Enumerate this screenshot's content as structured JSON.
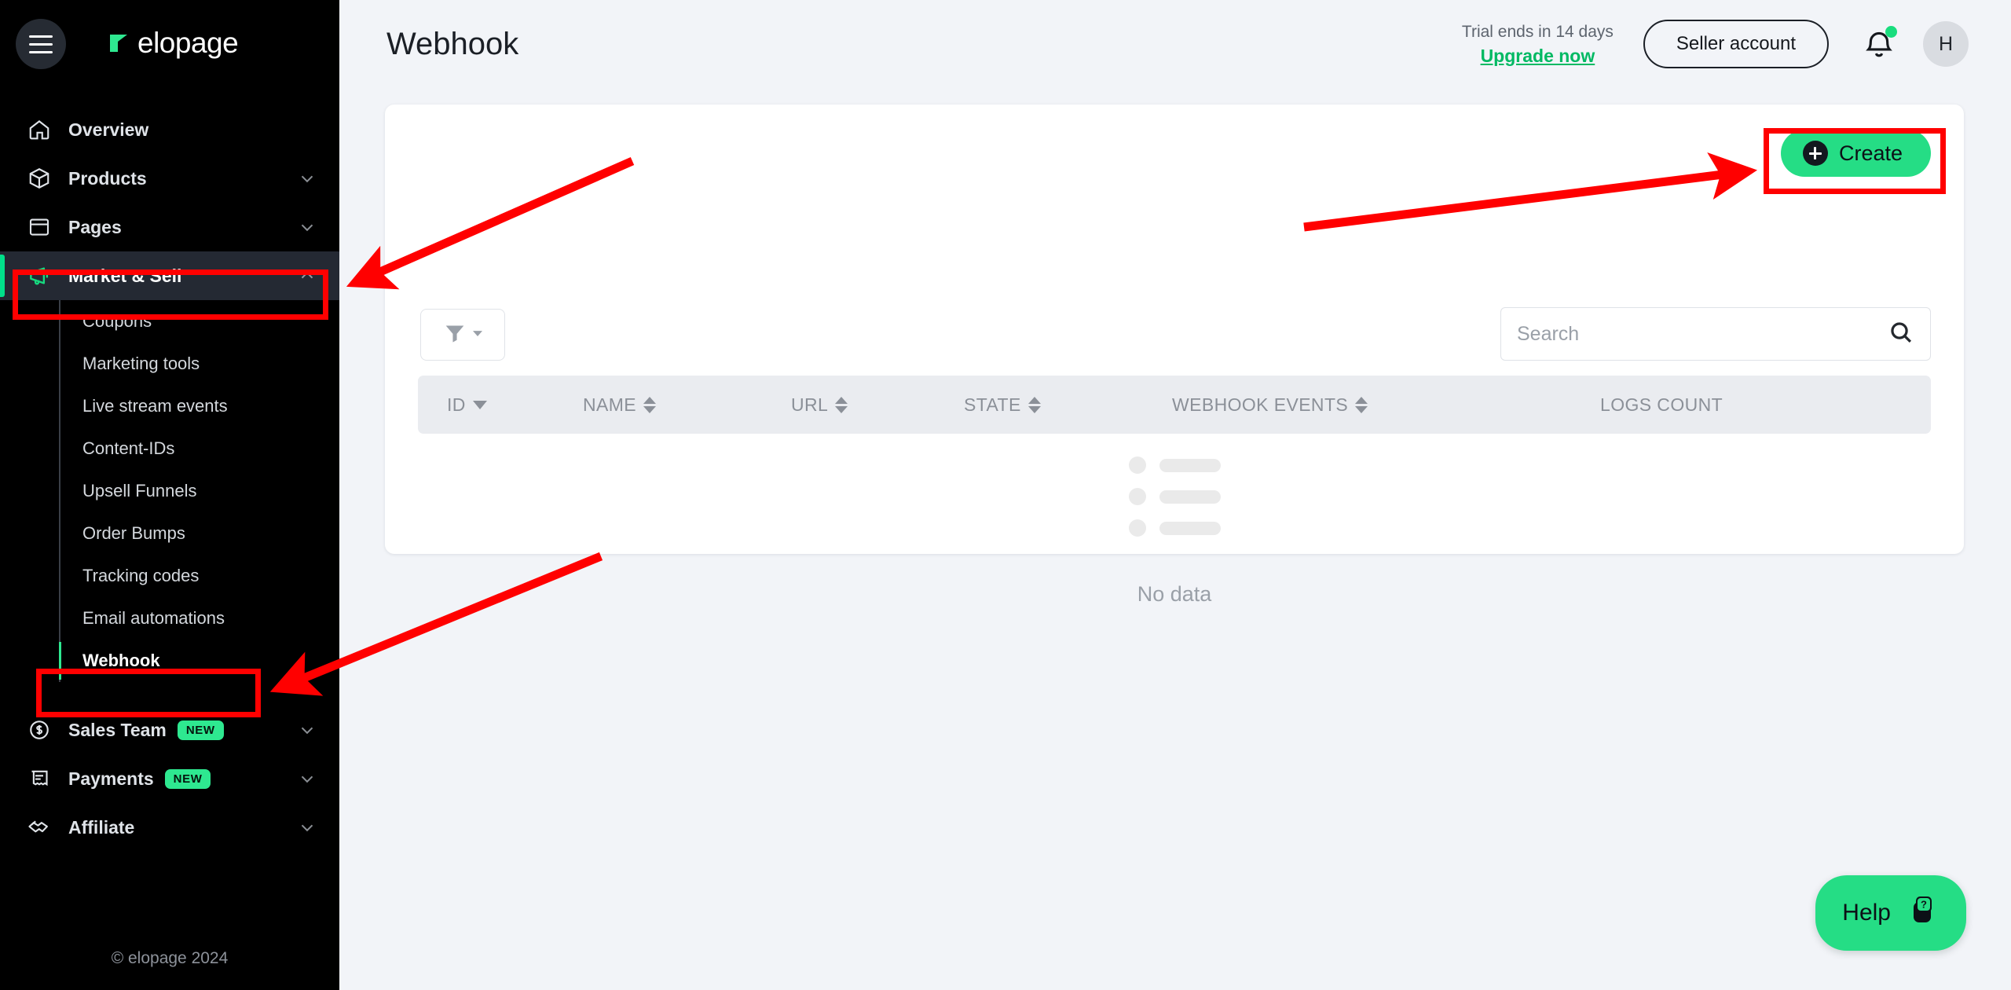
{
  "brand": {
    "name": "elopage",
    "accent": "#25dd85",
    "sidebar_bg": "#000000"
  },
  "sidebar": {
    "menu_icon": "hamburger-menu-icon",
    "footer": "© elopage 2024",
    "items": [
      {
        "label": "Overview",
        "icon": "home-icon",
        "expandable": false,
        "active": false
      },
      {
        "label": "Products",
        "icon": "box-icon",
        "expandable": true,
        "active": false
      },
      {
        "label": "Pages",
        "icon": "window-icon",
        "expandable": true,
        "active": false
      },
      {
        "label": "Market & Sell",
        "icon": "megaphone-icon",
        "expandable": true,
        "active": true
      },
      {
        "label": "Sales Team",
        "icon": "dollar-circle-icon",
        "expandable": true,
        "active": false,
        "badge": "NEW"
      },
      {
        "label": "Payments",
        "icon": "receipt-icon",
        "expandable": true,
        "active": false,
        "badge": "NEW"
      },
      {
        "label": "Affiliate",
        "icon": "handshake-icon",
        "expandable": true,
        "active": false
      }
    ],
    "submenu": [
      {
        "label": "Coupons",
        "active": false
      },
      {
        "label": "Marketing tools",
        "active": false
      },
      {
        "label": "Live stream events",
        "active": false
      },
      {
        "label": "Content-IDs",
        "active": false
      },
      {
        "label": "Upsell Funnels",
        "active": false
      },
      {
        "label": "Order Bumps",
        "active": false
      },
      {
        "label": "Tracking codes",
        "active": false
      },
      {
        "label": "Email automations",
        "active": false
      },
      {
        "label": "Webhook",
        "active": true
      }
    ]
  },
  "header": {
    "title": "Webhook",
    "trial_text": "Trial ends in 14 days",
    "upgrade_label": "Upgrade now",
    "seller_account_label": "Seller account",
    "notification_icon": "bell-icon",
    "has_notification_dot": true,
    "avatar_initial": "H"
  },
  "toolbar": {
    "create_label": "Create",
    "create_icon": "plus-circle-icon",
    "filter_icon": "funnel-icon",
    "search_placeholder": "Search",
    "search_value": "",
    "search_icon": "magnifier-icon"
  },
  "table": {
    "columns": [
      {
        "label": "ID",
        "sort": "desc"
      },
      {
        "label": "NAME",
        "sort": "both"
      },
      {
        "label": "URL",
        "sort": "both"
      },
      {
        "label": "STATE",
        "sort": "both"
      },
      {
        "label": "WEBHOOK EVENTS",
        "sort": "both"
      },
      {
        "label": "LOGS COUNT",
        "sort": "none"
      }
    ],
    "rows": [],
    "empty_text": "No data",
    "placeholder_rows": 3
  },
  "help": {
    "label": "Help",
    "icon": "chat-question-icon"
  },
  "annotations": {
    "color": "#ff0000",
    "boxes": [
      "Market & Sell",
      "Webhook",
      "Create"
    ],
    "arrows": 3
  }
}
